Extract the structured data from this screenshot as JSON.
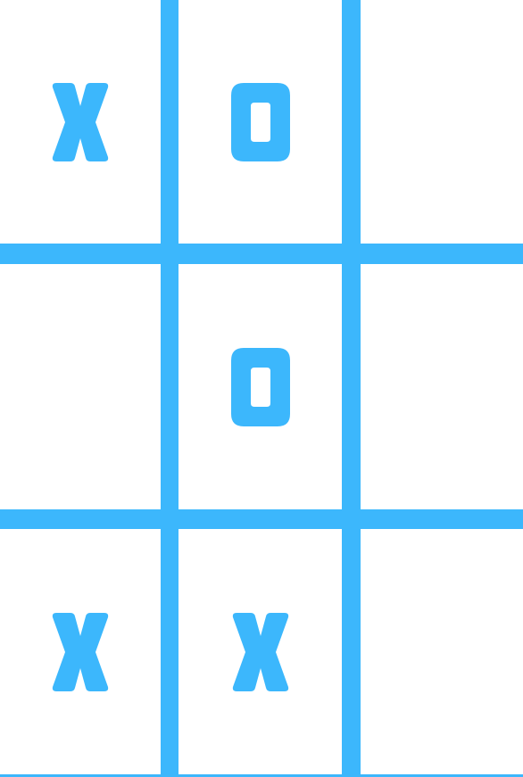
{
  "board": {
    "grid_color": "#3cb7fc",
    "mark_color": "#3cb7fc",
    "background": "#ffffff",
    "cells": [
      {
        "row": 0,
        "col": 0,
        "mark": "X"
      },
      {
        "row": 0,
        "col": 1,
        "mark": "O"
      },
      {
        "row": 0,
        "col": 2,
        "mark": ""
      },
      {
        "row": 1,
        "col": 0,
        "mark": ""
      },
      {
        "row": 1,
        "col": 1,
        "mark": "O"
      },
      {
        "row": 1,
        "col": 2,
        "mark": ""
      },
      {
        "row": 2,
        "col": 0,
        "mark": "X"
      },
      {
        "row": 2,
        "col": 1,
        "mark": "X"
      },
      {
        "row": 2,
        "col": 2,
        "mark": ""
      }
    ]
  }
}
